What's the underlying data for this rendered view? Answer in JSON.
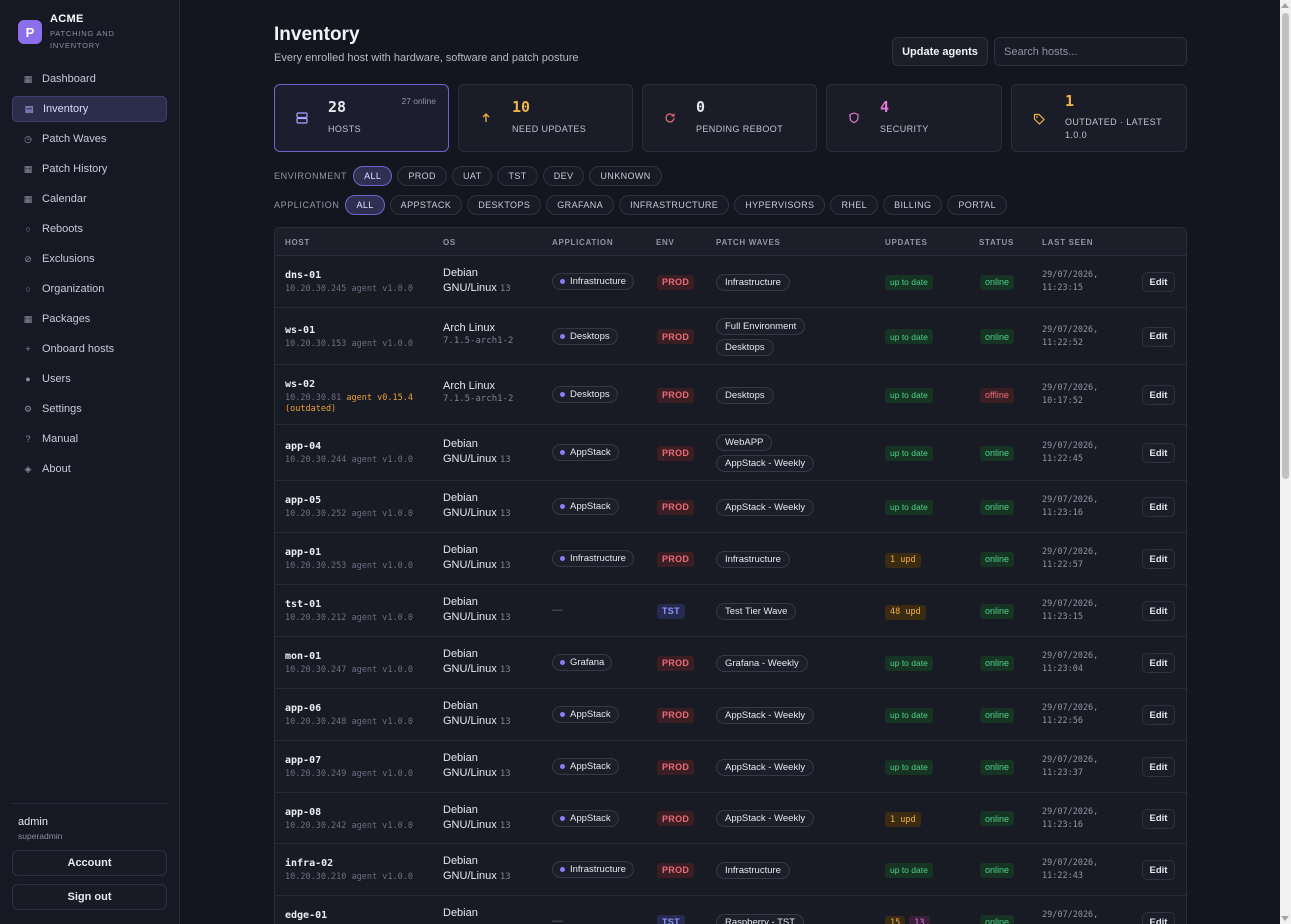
{
  "brand": {
    "logo_letter": "P",
    "name": "ACME",
    "subtitle_line1": "PATCHING AND",
    "subtitle_line2": "INVENTORY"
  },
  "sidebar": {
    "items": [
      {
        "label": "Dashboard",
        "icon": "dashboard-icon",
        "glyph": "▦"
      },
      {
        "label": "Inventory",
        "icon": "inventory-icon",
        "glyph": "▤",
        "active": true
      },
      {
        "label": "Patch Waves",
        "icon": "clock-icon",
        "glyph": "◷"
      },
      {
        "label": "Patch History",
        "icon": "history-icon",
        "glyph": "▦"
      },
      {
        "label": "Calendar",
        "icon": "calendar-icon",
        "glyph": "▦"
      },
      {
        "label": "Reboots",
        "icon": "reboot-icon",
        "glyph": "○"
      },
      {
        "label": "Exclusions",
        "icon": "exclusion-icon",
        "glyph": "⊘"
      },
      {
        "label": "Organization",
        "icon": "organization-icon",
        "glyph": "○"
      },
      {
        "label": "Packages",
        "icon": "package-icon",
        "glyph": "▦"
      },
      {
        "label": "Onboard hosts",
        "icon": "plus-icon",
        "glyph": "+"
      },
      {
        "label": "Users",
        "icon": "users-icon",
        "glyph": "●"
      },
      {
        "label": "Settings",
        "icon": "gear-icon",
        "glyph": "⚙"
      },
      {
        "label": "Manual",
        "icon": "help-icon",
        "glyph": "?"
      },
      {
        "label": "About",
        "icon": "info-icon",
        "glyph": "◈"
      }
    ],
    "user": {
      "name": "admin",
      "role": "superadmin"
    },
    "account_label": "Account",
    "signout_label": "Sign out"
  },
  "header": {
    "title": "Inventory",
    "subtitle": "Every enrolled host with hardware, software and patch posture",
    "update_agents_label": "Update agents",
    "search_placeholder": "Search hosts..."
  },
  "stats": [
    {
      "value": "28",
      "label": "HOSTS",
      "corner": "27 online",
      "icon": "server-icon",
      "color": "#e6e8ee",
      "icon_color": "#a8a5ff"
    },
    {
      "value": "10",
      "label": "NEED UPDATES",
      "icon": "arrow-up-icon",
      "color": "#f0b24a",
      "icon_color": "#f0b24a"
    },
    {
      "value": "0",
      "label": "PENDING REBOOT",
      "icon": "refresh-icon",
      "color": "#e6e8ee",
      "icon_color": "#ea6b78"
    },
    {
      "value": "4",
      "label": "SECURITY",
      "icon": "shield-icon",
      "color": "#e27ad8",
      "icon_color": "#e27ad8"
    },
    {
      "value": "1",
      "label": "OUTDATED · LATEST",
      "label2": "1.0.0",
      "icon": "tag-icon",
      "color": "#f0b24a",
      "icon_color": "#f0b24a"
    }
  ],
  "filters": {
    "environment": {
      "label": "ENVIRONMENT",
      "options": [
        "ALL",
        "PROD",
        "UAT",
        "TST",
        "DEV",
        "UNKNOWN"
      ],
      "active": "ALL"
    },
    "application": {
      "label": "APPLICATION",
      "options": [
        "ALL",
        "APPSTACK",
        "DESKTOPS",
        "GRAFANA",
        "INFRASTRUCTURE",
        "HYPERVISORS",
        "RHEL",
        "BILLING",
        "PORTAL"
      ],
      "active": "ALL"
    }
  },
  "table": {
    "columns": {
      "host": "HOST",
      "os": "OS",
      "application": "APPLICATION",
      "env": "ENV",
      "patch_waves": "PATCH WAVES",
      "updates": "UPDATES",
      "status": "STATUS",
      "last_seen": "LAST SEEN"
    },
    "edit_label": "Edit",
    "rows": [
      {
        "host": "dns-01",
        "ip": "10.20.30.245",
        "agent": "agent v1.0.0",
        "os_name": "Debian",
        "os_name2": "GNU/Linux",
        "os_ver": "13",
        "app": "Infrastructure",
        "env": "PROD",
        "waves": [
          "Infrastructure"
        ],
        "updates": "up to date",
        "status": "online",
        "seen1": "29/07/2026,",
        "seen2": "11:23:15"
      },
      {
        "host": "ws-01",
        "ip": "10.20.30.153",
        "agent": "agent v1.0.0",
        "os_name": "Arch Linux",
        "os_ver": "7.1.5-arch1-2",
        "app": "Desktops",
        "env": "PROD",
        "waves": [
          "Full Environment",
          "Desktops"
        ],
        "updates": "up to date",
        "status": "online",
        "seen1": "29/07/2026,",
        "seen2": "11:22:52"
      },
      {
        "host": "ws-02",
        "ip": "10.20.30.81",
        "agent": "agent v0.15.4",
        "agent_outdated": "(outdated)",
        "os_name": "Arch Linux",
        "os_ver": "7.1.5-arch1-2",
        "app": "Desktops",
        "env": "PROD",
        "waves": [
          "Desktops"
        ],
        "updates": "up to date",
        "status": "offline",
        "seen1": "29/07/2026,",
        "seen2": "10:17:52"
      },
      {
        "host": "app-04",
        "ip": "10.20.30.244",
        "agent": "agent v1.0.0",
        "os_name": "Debian",
        "os_name2": "GNU/Linux",
        "os_ver": "13",
        "app": "AppStack",
        "env": "PROD",
        "waves": [
          "WebAPP",
          "AppStack - Weekly"
        ],
        "updates": "up to date",
        "status": "online",
        "seen1": "29/07/2026,",
        "seen2": "11:22:45"
      },
      {
        "host": "app-05",
        "ip": "10.20.30.252",
        "agent": "agent v1.0.0",
        "os_name": "Debian",
        "os_name2": "GNU/Linux",
        "os_ver": "13",
        "app": "AppStack",
        "env": "PROD",
        "waves": [
          "AppStack - Weekly"
        ],
        "updates": "up to date",
        "status": "online",
        "seen1": "29/07/2026,",
        "seen2": "11:23:16"
      },
      {
        "host": "app-01",
        "ip": "10.20.30.253",
        "agent": "agent v1.0.0",
        "os_name": "Debian",
        "os_name2": "GNU/Linux",
        "os_ver": "13",
        "app": "Infrastructure",
        "env": "PROD",
        "waves": [
          "Infrastructure"
        ],
        "updates": "1 upd",
        "updates_kind": "warn",
        "status": "online",
        "seen1": "29/07/2026,",
        "seen2": "11:22:57"
      },
      {
        "host": "tst-01",
        "ip": "10.20.30.212",
        "agent": "agent v1.0.0",
        "os_name": "Debian",
        "os_name2": "GNU/Linux",
        "os_ver": "13",
        "app": "",
        "env": "TST",
        "waves": [
          "Test Tier Wave"
        ],
        "updates": "48 upd",
        "updates_kind": "warn",
        "status": "online",
        "seen1": "29/07/2026,",
        "seen2": "11:23:15"
      },
      {
        "host": "mon-01",
        "ip": "10.20.30.247",
        "agent": "agent v1.0.0",
        "os_name": "Debian",
        "os_name2": "GNU/Linux",
        "os_ver": "13",
        "app": "Grafana",
        "env": "PROD",
        "waves": [
          "Grafana - Weekly"
        ],
        "updates": "up to date",
        "status": "online",
        "seen1": "29/07/2026,",
        "seen2": "11:23:04"
      },
      {
        "host": "app-06",
        "ip": "10.20.30.248",
        "agent": "agent v1.0.0",
        "os_name": "Debian",
        "os_name2": "GNU/Linux",
        "os_ver": "13",
        "app": "AppStack",
        "env": "PROD",
        "waves": [
          "AppStack - Weekly"
        ],
        "updates": "up to date",
        "status": "online",
        "seen1": "29/07/2026,",
        "seen2": "11:22:56"
      },
      {
        "host": "app-07",
        "ip": "10.20.30.249",
        "agent": "agent v1.0.0",
        "os_name": "Debian",
        "os_name2": "GNU/Linux",
        "os_ver": "13",
        "app": "AppStack",
        "env": "PROD",
        "waves": [
          "AppStack - Weekly"
        ],
        "updates": "up to date",
        "status": "online",
        "seen1": "29/07/2026,",
        "seen2": "11:23:37"
      },
      {
        "host": "app-08",
        "ip": "10.20.30.242",
        "agent": "agent v1.0.0",
        "os_name": "Debian",
        "os_name2": "GNU/Linux",
        "os_ver": "13",
        "app": "AppStack",
        "env": "PROD",
        "waves": [
          "AppStack - Weekly"
        ],
        "updates": "1 upd",
        "updates_kind": "warn",
        "status": "online",
        "seen1": "29/07/2026,",
        "seen2": "11:23:16"
      },
      {
        "host": "infra-02",
        "ip": "10.20.30.210",
        "agent": "agent v1.0.0",
        "os_name": "Debian",
        "os_name2": "GNU/Linux",
        "os_ver": "13",
        "app": "Infrastructure",
        "env": "PROD",
        "waves": [
          "Infrastructure"
        ],
        "updates": "up to date",
        "status": "online",
        "seen1": "29/07/2026,",
        "seen2": "11:22:43"
      },
      {
        "host": "edge-01",
        "ip": "",
        "agent": "",
        "os_name": "Debian",
        "os_name2": "",
        "os_ver": "",
        "app": "",
        "env": "TST",
        "waves": [
          "Raspberry - TST"
        ],
        "updates": "15",
        "updates_kind": "warn",
        "updates_sec": "13",
        "status": "online",
        "seen1": "29/07/2026,",
        "seen2": ""
      }
    ]
  }
}
